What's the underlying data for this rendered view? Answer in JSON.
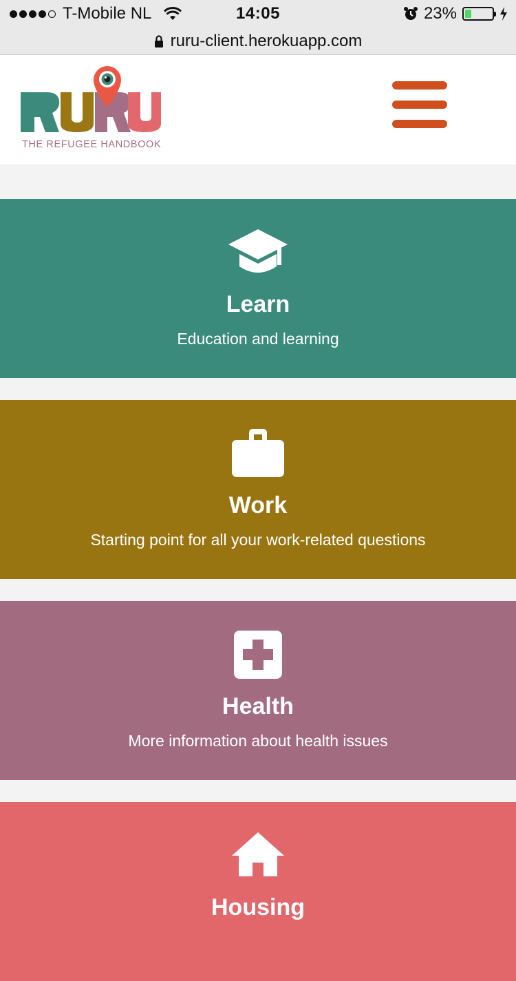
{
  "status_bar": {
    "carrier": "T-Mobile NL",
    "signal_bars_filled": 4,
    "signal_bars_total": 5,
    "time": "14:05",
    "battery_percent_label": "23%",
    "battery_level": 0.23,
    "icons": [
      "signal-dots-icon",
      "wifi-icon",
      "alarm-icon",
      "battery-icon",
      "charging-bolt-icon"
    ]
  },
  "browser": {
    "url": "ruru-client.herokuapp.com",
    "lock_icon": "lock-icon"
  },
  "header": {
    "logo_text": "RURU",
    "logo_tagline": "THE REFUGEE HANDBOOK",
    "menu_icon": "hamburger-menu-icon",
    "colors": {
      "menu": "#cf4f1e",
      "logo_teal": "#3b8a7c",
      "logo_olive": "#9a7614",
      "logo_mauve": "#a46e87",
      "logo_coral": "#e3686d"
    }
  },
  "categories": [
    {
      "title": "Learn",
      "subtitle": "Education and learning",
      "icon": "graduation-cap-icon",
      "color": "#3a8b7c"
    },
    {
      "title": "Work",
      "subtitle": "Starting point for all your work-related questions",
      "icon": "briefcase-icon",
      "color": "#997512"
    },
    {
      "title": "Health",
      "subtitle": "More information about health issues",
      "icon": "medical-cross-icon",
      "color": "#a26b80"
    },
    {
      "title": "Housing",
      "subtitle": "",
      "icon": "house-icon",
      "color": "#e2676b"
    }
  ]
}
